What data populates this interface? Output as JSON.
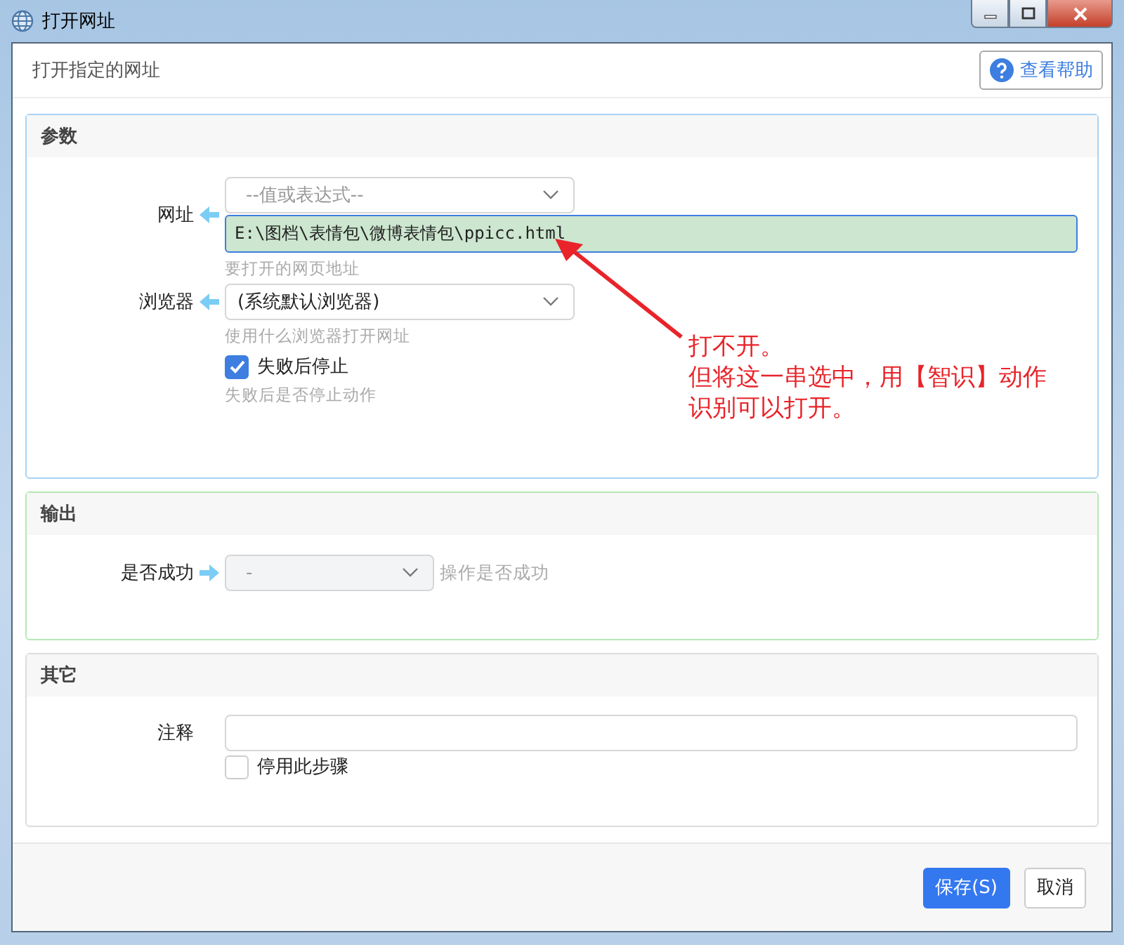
{
  "window": {
    "title": "打开网址"
  },
  "header": {
    "description": "打开指定的网址",
    "help_button": "查看帮助"
  },
  "sections": [
    {
      "title": "参数",
      "color": "#a9d3f5",
      "fields": [
        {
          "kind": "expr",
          "label": "网址",
          "placeholder": "--值或表达式--",
          "value": "E:\\图档\\表情包\\微博表情包\\ppicc.html",
          "hint": "要打开的网页地址"
        },
        {
          "kind": "select",
          "label": "浏览器",
          "value": "(系统默认浏览器)",
          "hint": "使用什么浏览器打开网址"
        },
        {
          "kind": "checkbox",
          "label": "失败后停止",
          "checked": true,
          "hint": "失败后是否停止动作"
        }
      ]
    },
    {
      "title": "输出",
      "color": "#b5e8b5",
      "fields": [
        {
          "kind": "output",
          "label": "是否成功",
          "value": "-",
          "hint": "操作是否成功"
        }
      ]
    },
    {
      "title": "其它",
      "color": "#dddddd",
      "fields": [
        {
          "kind": "text",
          "label": "注释"
        },
        {
          "kind": "checkbox",
          "label": "停用此步骤",
          "checked": false
        }
      ]
    }
  ],
  "annotation": {
    "lines": [
      "打不开。",
      "但将这一串选中，用【智识】动作",
      "识别可以打开。"
    ]
  },
  "buttons": [
    {
      "label": "保存(S)",
      "kind": "primary"
    },
    {
      "label": "取消",
      "kind": "default"
    }
  ]
}
